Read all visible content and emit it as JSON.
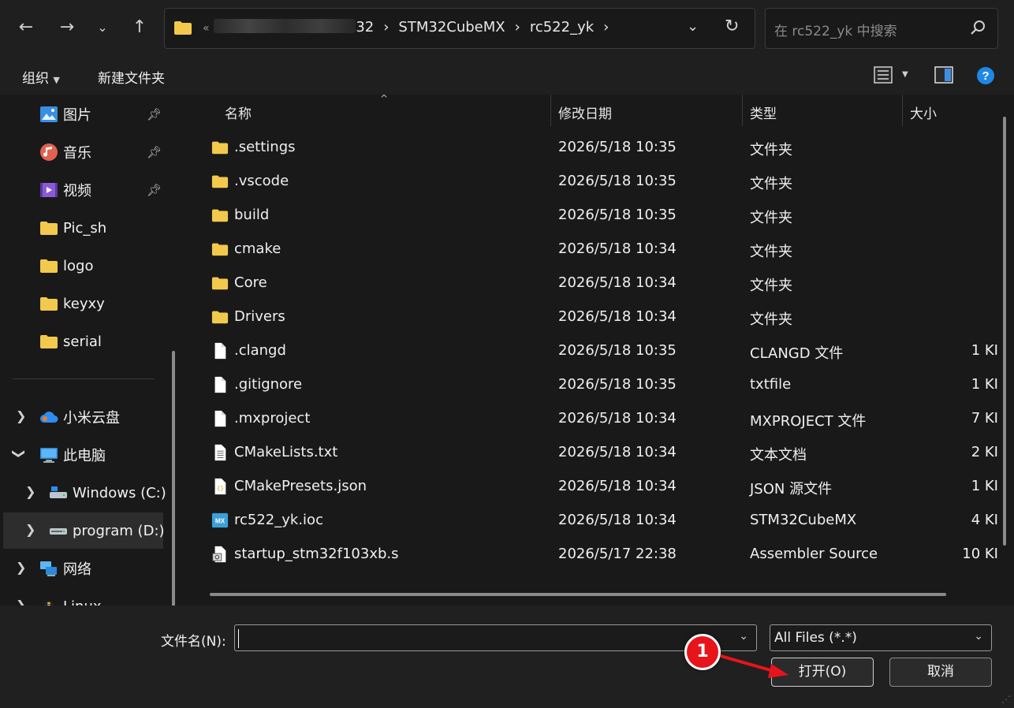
{
  "address": {
    "crumbs": [
      "32",
      "STM32CubeMX",
      "rc522_yk"
    ],
    "prefix": "«",
    "separator": "›"
  },
  "search": {
    "placeholder": "在 rc522_yk 中搜索"
  },
  "command_bar": {
    "organize": "组织",
    "new_folder": "新建文件夹"
  },
  "nav": {
    "quick": [
      {
        "label": "图片",
        "icon": "pictures-icon",
        "pinned": true
      },
      {
        "label": "音乐",
        "icon": "music-icon",
        "pinned": true
      },
      {
        "label": "视频",
        "icon": "videos-icon",
        "pinned": true
      },
      {
        "label": "Pic_sh",
        "icon": "folder-icon"
      },
      {
        "label": "logo",
        "icon": "folder-icon"
      },
      {
        "label": "keyxy",
        "icon": "folder-icon"
      },
      {
        "label": "serial",
        "icon": "folder-icon"
      }
    ],
    "tree": [
      {
        "label": "小米云盘",
        "icon": "cloud-icon",
        "chevron": ">"
      },
      {
        "label": "此电脑",
        "icon": "computer-icon",
        "chevron": "v"
      },
      {
        "label": "Windows (C:)",
        "icon": "drive-icon",
        "chevron": ">"
      },
      {
        "label": "program (D:)",
        "icon": "drive-icon",
        "chevron": ">"
      },
      {
        "label": "网络",
        "icon": "network-icon",
        "chevron": ">"
      },
      {
        "label": "Linux",
        "icon": "linux-icon",
        "chevron": ">"
      }
    ]
  },
  "columns": {
    "name": "名称",
    "modified": "修改日期",
    "type": "类型",
    "size": "大小"
  },
  "files": [
    {
      "name": ".settings",
      "modified": "2026/5/18 10:35",
      "type": "文件夹",
      "size": "",
      "icon": "folder-icon"
    },
    {
      "name": ".vscode",
      "modified": "2026/5/18 10:35",
      "type": "文件夹",
      "size": "",
      "icon": "folder-icon"
    },
    {
      "name": "build",
      "modified": "2026/5/18 10:35",
      "type": "文件夹",
      "size": "",
      "icon": "folder-icon"
    },
    {
      "name": "cmake",
      "modified": "2026/5/18 10:34",
      "type": "文件夹",
      "size": "",
      "icon": "folder-icon"
    },
    {
      "name": "Core",
      "modified": "2026/5/18 10:34",
      "type": "文件夹",
      "size": "",
      "icon": "folder-icon"
    },
    {
      "name": "Drivers",
      "modified": "2026/5/18 10:34",
      "type": "文件夹",
      "size": "",
      "icon": "folder-icon"
    },
    {
      "name": ".clangd",
      "modified": "2026/5/18 10:35",
      "type": "CLANGD 文件",
      "size": "1 KI",
      "icon": "file-icon"
    },
    {
      "name": ".gitignore",
      "modified": "2026/5/18 10:35",
      "type": "txtfile",
      "size": "1 KI",
      "icon": "file-icon"
    },
    {
      "name": ".mxproject",
      "modified": "2026/5/18 10:34",
      "type": "MXPROJECT 文件",
      "size": "7 KI",
      "icon": "file-icon"
    },
    {
      "name": "CMakeLists.txt",
      "modified": "2026/5/18 10:34",
      "type": "文本文档",
      "size": "2 KI",
      "icon": "text-file-icon"
    },
    {
      "name": "CMakePresets.json",
      "modified": "2026/5/18 10:34",
      "type": "JSON 源文件",
      "size": "1 KI",
      "icon": "json-file-icon"
    },
    {
      "name": "rc522_yk.ioc",
      "modified": "2026/5/18 10:34",
      "type": "STM32CubeMX",
      "size": "4 KI",
      "icon": "mx-file-icon"
    },
    {
      "name": "startup_stm32f103xb.s",
      "modified": "2026/5/17 22:38",
      "type": "Assembler Source",
      "size": "10 KI",
      "icon": "asm-file-icon"
    }
  ],
  "bottom": {
    "filename_label": "文件名(N):",
    "filename_value": "",
    "filter": "All Files (*.*)",
    "open": "打开(O)",
    "cancel": "取消"
  },
  "annotation": {
    "number": "1",
    "color": "#e8141c"
  },
  "colors": {
    "background": "#191919",
    "folder": "#f2c94c",
    "accent_help": "#1e88e5"
  }
}
